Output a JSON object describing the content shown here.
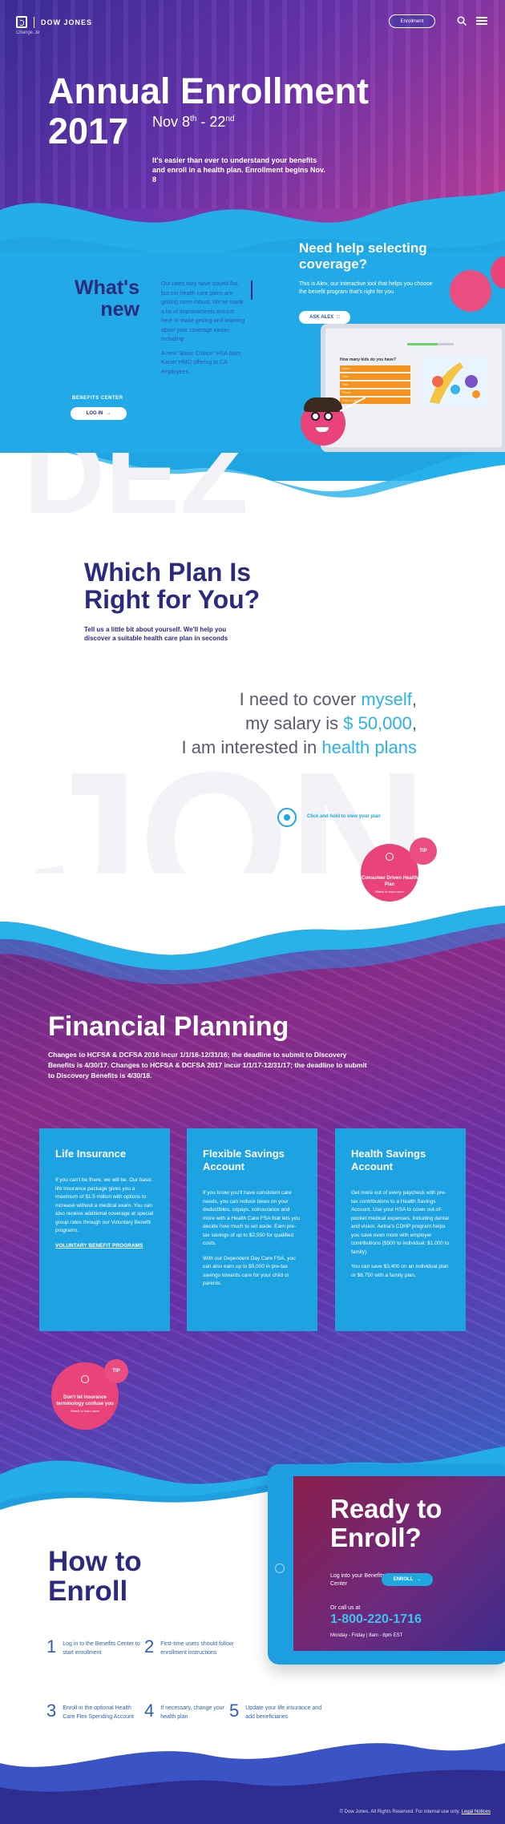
{
  "header": {
    "brand": "DOW JONES",
    "brand_sub": "Change..te",
    "enroll_label": "Enrollment",
    "icons": [
      "search-icon",
      "menu-icon"
    ]
  },
  "hero": {
    "title": "Annual Enrollment",
    "year": "2017",
    "dates_prefix": "Nov 8",
    "dates_sup1": "th",
    "dates_mid": " - 22",
    "dates_sup2": "nd",
    "description": "It's easier than ever to understand your benefits and enroll in a health plan. Enrollment begins Nov. 8"
  },
  "whats_new": {
    "title_line1": "What's",
    "title_line2": "new",
    "paragraph1": "Our rates may have stayed flat, but our health care plans are getting more robust. We've made a lot of improvements around here to make getting and learning about your coverage easier, including:",
    "paragraph2": "A new \"Basic Choice\" HSA plan; Kaiser HMO offering to CA employees.",
    "benefits_center_label": "BENEFITS CENTER",
    "login_label": "LOG IN"
  },
  "help": {
    "title": "Need help selecting coverage?",
    "description": "This is Alex, our interactive tool that helps you choose the benefit program that's right for you",
    "ask_label": "ASK ALEX",
    "laptop_question": "How many kids do you have?",
    "laptop_options": [
      "None",
      "One",
      "Two",
      "Three",
      "Four or more"
    ]
  },
  "plan": {
    "title_line1": "Which Plan Is",
    "title_line2": "Right for You?",
    "description": "Tell us a little bit about yourself. We'll help you discover a suitable health care plan in seconds",
    "line1_pre": "I need to cover ",
    "line1_hl": "myself",
    "line1_post": ",",
    "line2_pre": "my salary is ",
    "line2_hl": "$ 50,000",
    "line2_post": ",",
    "line3_pre": "I am interested in ",
    "line3_hl": "health plans",
    "drag_label": "Click and hold to view your plan",
    "watermark": "JON",
    "tip_badge": "TIP",
    "tip_title": "Consumer Driven Health Plan",
    "tip_sub": "Watch to learn more"
  },
  "financial": {
    "title": "Financial Planning",
    "description": "Changes to HCFSA & DCFSA 2016 incur 1/1/16-12/31/16; the deadline to submit to Discovery Benefits is 4/30/17. Changes to HCFSA & DCFSA 2017 incur 1/1/17-12/31/17; the deadline to submit to Discovery Benefits is 4/30/18.",
    "cards": [
      {
        "title": "Life Insurance",
        "p1": "If you can't be there, we will be. Our basic life insurance package gives you a maximum of $1.5 million with options to increase without a medical exam. You can also receive additional coverage at special group rates through our Voluntary Benefit programs.",
        "link": "VOLUNTARY BENEFIT PROGRAMS"
      },
      {
        "title": "Flexible Savings Account",
        "p1": "If you know you'll have consistent care needs, you can reduce taxes on your deductibles, copays, coinsurance and more with a Health Care FSA that lets you decide how much to set aside. Earn pre-tax savings of up to $2,550 for qualified costs.",
        "p2": "With our Dependent Day Care FSA, you can also earn up to $5,000 in pre-tax savings towards care for your child or parents."
      },
      {
        "title": "Health Savings Account",
        "p1": "Get more out of every paycheck with pre-tax contributions to a Health Savings Account. Use your HSA to cover out-of-pocket medical expenses, including dental and vision. Aetna's CDHP program helps you save even more with employer contributions ($500 to individual; $1,000 to family).",
        "p2": "You can save $3,400 on an individual plan or $6,750 with a family plan."
      }
    ],
    "tip_badge": "TIP",
    "tip_title": "Don't let insurance terminology confuse you",
    "tip_sub": "Watch to learn more"
  },
  "enroll": {
    "title_line1": "How to",
    "title_line2": "Enroll",
    "steps": [
      {
        "num": "1",
        "text": "Log in to the Benefits Center to start enrollment"
      },
      {
        "num": "2",
        "text": "First-time users should follow enrollment instructions"
      },
      {
        "num": "3",
        "text": "Enroll in the optional Health Care Flex Spending Account"
      },
      {
        "num": "4",
        "text": "If necessary, change your health plan"
      },
      {
        "num": "5",
        "text": "Update your life insurance and add beneficiaries"
      }
    ],
    "ready_line1": "Ready to",
    "ready_line2": "Enroll?",
    "login_text": "Log into your Benefits Center",
    "enroll_btn": "ENROLL",
    "call_text": "Or call us at",
    "phone": "1-800-220-1716",
    "hours": "Monday - Friday  |  8am - 8pm EST"
  },
  "footer": {
    "text": "© Dow Jones. All Rights Reserved. For internal use only.",
    "legal": "Legal Notices"
  },
  "colors": {
    "navy": "#2c2a7e",
    "blue": "#1da2e2",
    "pink": "#e9437a",
    "purple": "#6a34b0"
  }
}
